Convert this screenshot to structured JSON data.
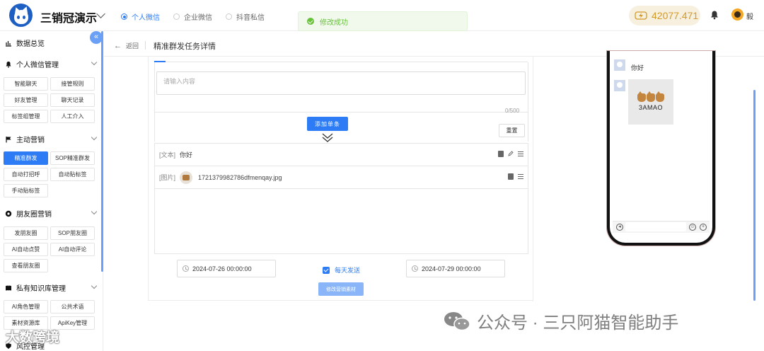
{
  "app": {
    "name": "三销冠演示"
  },
  "header": {
    "tabs": [
      {
        "label": "个人微信",
        "active": true
      },
      {
        "label": "企业微信",
        "active": false
      },
      {
        "label": "抖音私信",
        "active": false
      }
    ],
    "toast": "修改成功",
    "balance": "42077.471",
    "user_name": "毅",
    "accent_color": "#2d7cf6"
  },
  "sidebar": {
    "overview": "数据总览",
    "sections": [
      {
        "title": "个人微信管理",
        "icon": "bell-icon",
        "items": [
          "智能聊天",
          "接管规则",
          "好友管理",
          "聊天记录",
          "标签组管理",
          "人工介入"
        ]
      },
      {
        "title": "主动营销",
        "icon": "flag-icon",
        "items": [
          "精准群发",
          "SOP精准群发",
          "自动打招呼",
          "自动贴标签",
          "手动贴标签"
        ],
        "active_item": "精准群发"
      },
      {
        "title": "朋友圈营销",
        "icon": "aperture-icon",
        "items": [
          "发朋友圈",
          "SOP朋友圈",
          "AI自动点赞",
          "AI自动评论",
          "查看朋友圈"
        ]
      },
      {
        "title": "私有知识库管理",
        "icon": "book-icon",
        "items": [
          "AI角色管理",
          "公共术语",
          "素材资源库",
          "ApiKey管理"
        ]
      },
      {
        "title": "风控管理",
        "icon": "shield-icon",
        "items": []
      }
    ]
  },
  "page": {
    "back_label": "返回",
    "title": "精准群发任务详情",
    "textarea_placeholder": "请输入内容",
    "counter": "0/500",
    "add_button": "添加单条",
    "reset_button": "重置",
    "messages": [
      {
        "tag": "[文本]",
        "content": "你好"
      },
      {
        "tag": "[图片]",
        "content": "1721379982786dfmenqay.jpg"
      }
    ],
    "start_date": "2024-07-26 00:00:00",
    "daily_label": "每天发送",
    "daily_checked": true,
    "end_date": "2024-07-29 00:00:00",
    "submit_button": "修改营销素材"
  },
  "preview": {
    "chat_text": "你好",
    "image_brand": "3AMAO"
  },
  "watermarks": {
    "right": "公众号 · 三只阿猫智能助手",
    "left": "大数跨境"
  }
}
